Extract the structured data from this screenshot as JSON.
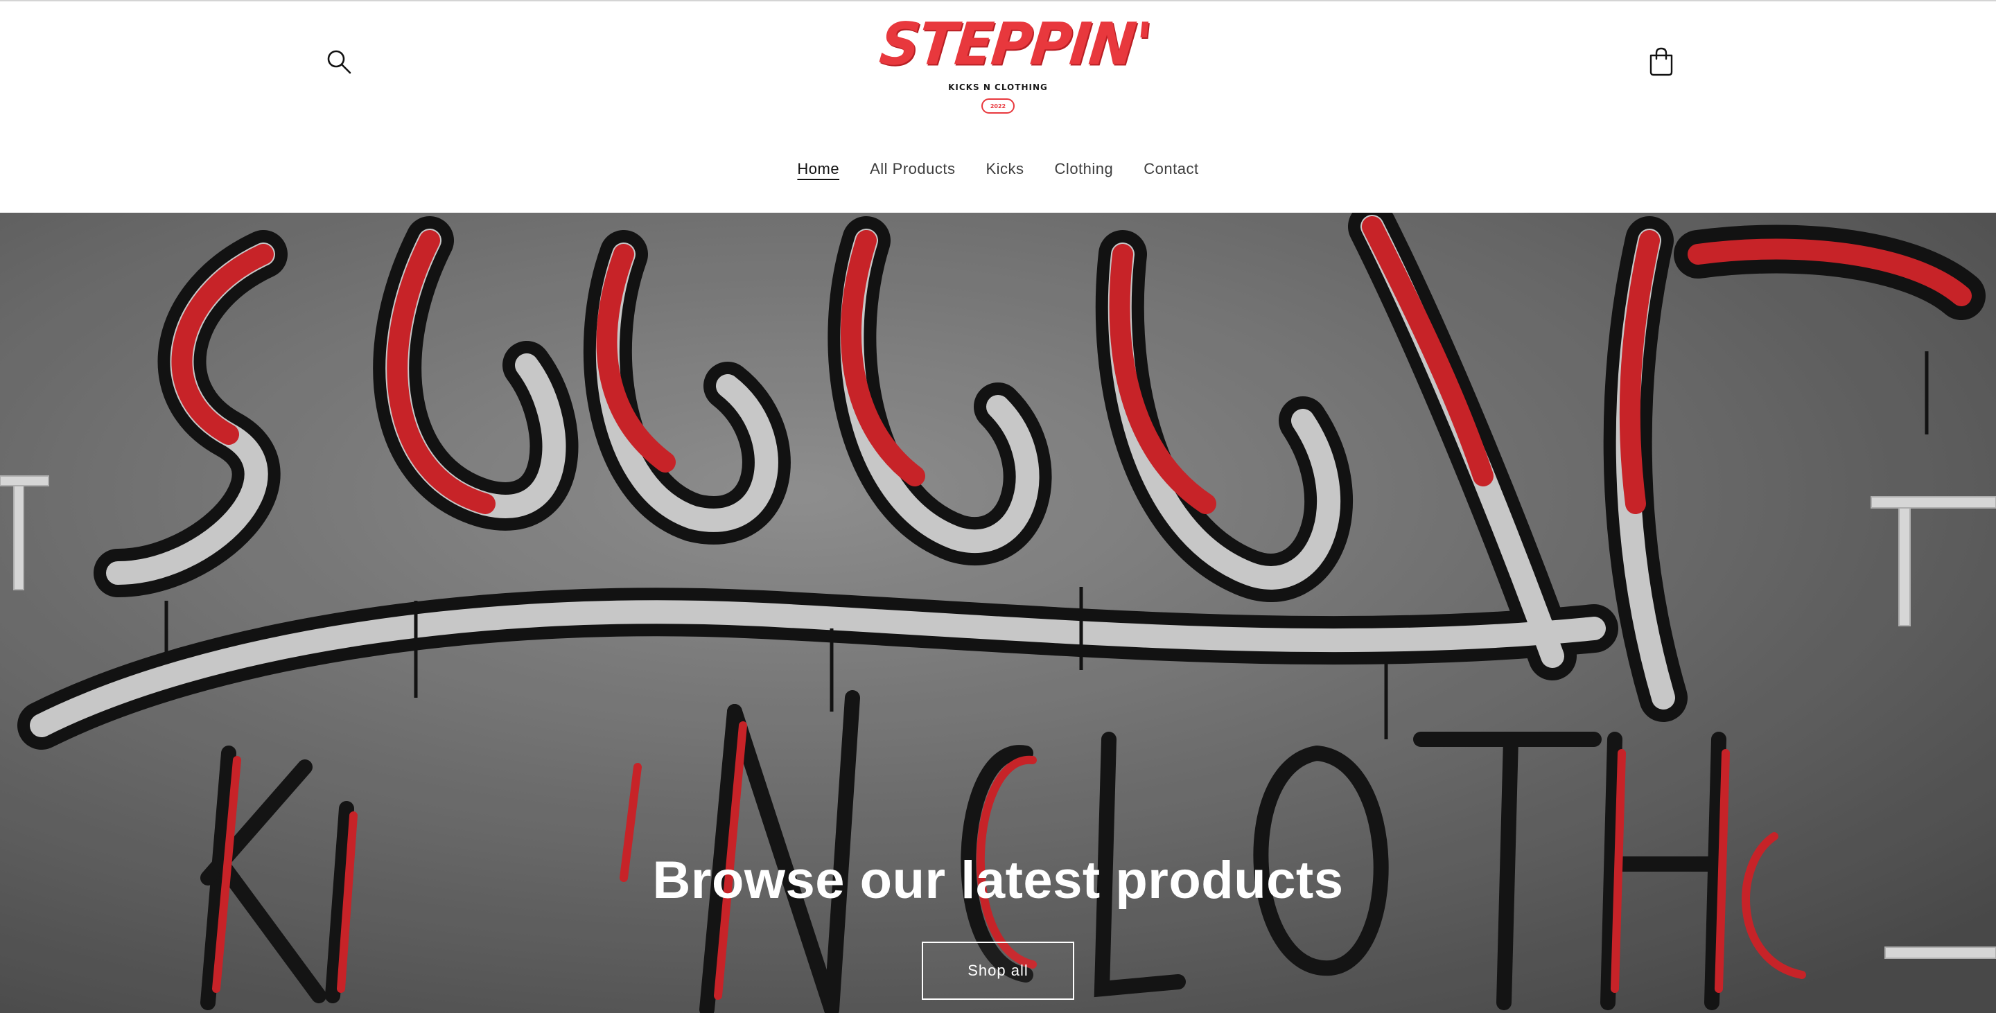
{
  "header": {
    "logo": {
      "wordmark": "STEPPIN'",
      "tagline": "KICKS N CLOTHING",
      "badge": "2022"
    },
    "search_icon": "search-icon",
    "cart_icon": "cart-icon"
  },
  "nav": {
    "items": [
      {
        "label": "Home",
        "active": true
      },
      {
        "label": "All Products",
        "active": false
      },
      {
        "label": "Kicks",
        "active": false
      },
      {
        "label": "Clothing",
        "active": false
      },
      {
        "label": "Contact",
        "active": false
      }
    ]
  },
  "hero": {
    "title": "Browse our latest products",
    "button_label": "Shop all"
  },
  "colors": {
    "brand_red": "#e8383d",
    "text": "#121212",
    "hero_text": "#ffffff"
  }
}
